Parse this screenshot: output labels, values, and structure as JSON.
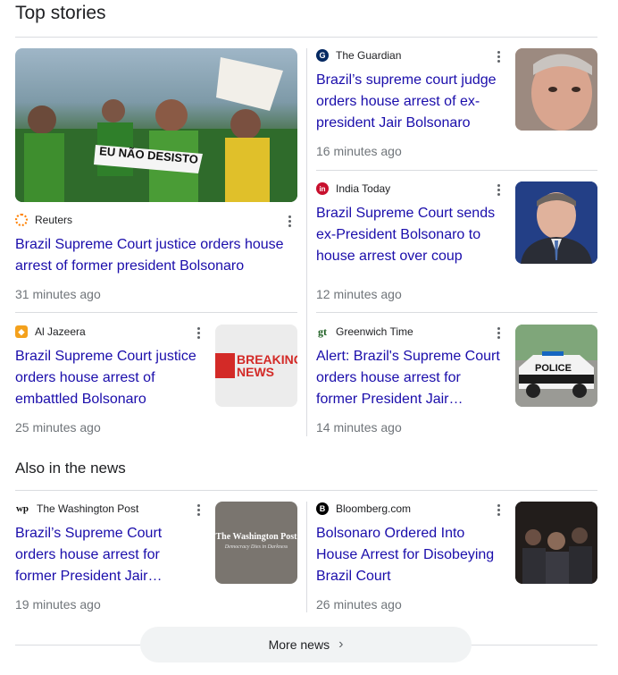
{
  "top_stories": {
    "title": "Top stories",
    "featured": {
      "source": "Reuters",
      "sign_text": "EU NÃO DESISTO",
      "headline": "Brazil Supreme Court justice orders house arrest of former president Bolsonaro",
      "time": "31 minutes ago"
    },
    "right_1": {
      "source": "The Guardian",
      "headline": "Brazil’s supreme court judge orders house arrest of ex-president Jair Bolsonaro",
      "time": "16 minutes ago"
    },
    "right_2": {
      "source": "India Today",
      "headline": "Brazil Supreme Court sends ex-President Bolsonaro to house arrest over coup",
      "time": "12 minutes ago"
    },
    "bottom_left": {
      "source": "Al Jazeera",
      "thumb_text": "BREAKING NEWS",
      "headline": "Brazil Supreme Court justice orders house arrest of embattled Bolsonaro",
      "time": "25 minutes ago"
    },
    "bottom_right": {
      "source": "Greenwich Time",
      "thumb_text": "POLICE",
      "headline": "Alert: Brazil's Supreme Court orders house arrest for former President Jair…",
      "time": "14 minutes ago"
    }
  },
  "also_in_news": {
    "title": "Also in the news",
    "left": {
      "source": "The Washington Post",
      "thumb_text": "The Washington Post",
      "thumb_subtext": "Democracy Dies in Darkness",
      "headline": "Brazil’s Supreme Court orders house arrest for former President Jair…",
      "time": "19 minutes ago"
    },
    "right": {
      "source": "Bloomberg.com",
      "headline": "Bolsonaro Ordered Into House Arrest for Disobeying Brazil Court",
      "time": "26 minutes ago"
    }
  },
  "more_news": {
    "label": "More news"
  },
  "colors": {
    "link": "#1a0dab",
    "meta": "#70757a",
    "divider": "#dadce0"
  }
}
